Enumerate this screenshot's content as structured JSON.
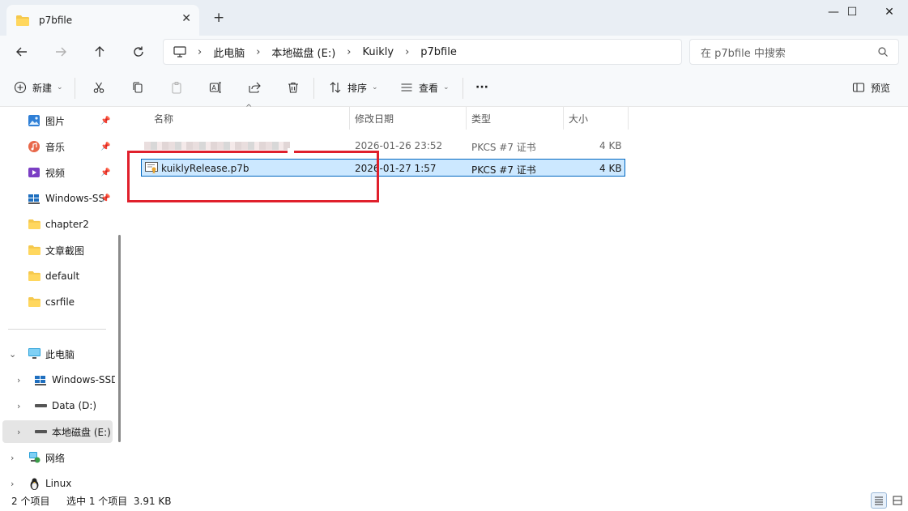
{
  "window": {
    "tab_title": "p7bfile",
    "tab_close": "✕",
    "new_tab": "+",
    "minimize": "—",
    "maximize": "☐",
    "close": "✕"
  },
  "address": {
    "breadcrumbs": [
      "此电脑",
      "本地磁盘 (E:)",
      "Kuikly",
      "p7bfile"
    ],
    "separator": "›",
    "search_placeholder": "在 p7bfile 中搜索"
  },
  "commands": {
    "new_label": "新建",
    "sort_label": "排序",
    "view_label": "查看",
    "more_label": "···",
    "preview_label": "预览"
  },
  "sidebar": {
    "quick_access": [
      {
        "label": "图片",
        "icon": "pictures-icon",
        "pinned": true
      },
      {
        "label": "音乐",
        "icon": "music-icon",
        "pinned": true
      },
      {
        "label": "视频",
        "icon": "videos-icon",
        "pinned": true
      },
      {
        "label": "Windows-SS",
        "icon": "windows-drive-icon",
        "pinned": true
      },
      {
        "label": "chapter2",
        "icon": "folder-icon",
        "pinned": false
      },
      {
        "label": "文章截图",
        "icon": "folder-icon",
        "pinned": false
      },
      {
        "label": "default",
        "icon": "folder-icon",
        "pinned": false
      },
      {
        "label": "csrfile",
        "icon": "folder-icon",
        "pinned": false
      }
    ],
    "tree": [
      {
        "label": "此电脑",
        "icon": "this-pc-icon",
        "expanded": true
      },
      {
        "label": "Windows-SSD",
        "icon": "windows-drive-icon"
      },
      {
        "label": "Data (D:)",
        "icon": "drive-icon"
      },
      {
        "label": "本地磁盘 (E:)",
        "icon": "drive-icon",
        "selected": true
      },
      {
        "label": "网络",
        "icon": "network-icon"
      },
      {
        "label": "Linux",
        "icon": "linux-icon"
      }
    ]
  },
  "file_list": {
    "columns": [
      "名称",
      "修改日期",
      "类型",
      "大小"
    ],
    "sort_indicator": "^",
    "rows": [
      {
        "name": "",
        "blurred": true,
        "modified": "2026-01-26 23:52",
        "type": "PKCS #7 证书",
        "size": "4 KB"
      },
      {
        "name": "kuiklyRelease.p7b",
        "blurred": false,
        "selected": true,
        "modified": "2026-01-27 1:57",
        "type": "PKCS #7 证书",
        "size": "4 KB"
      }
    ]
  },
  "status": {
    "item_count": "2 个项目",
    "selection": "选中 1 个项目  3.91 KB"
  },
  "colors": {
    "accent": "#0067c0",
    "selection_bg": "#cce8ff",
    "annotation_red": "#e0202c",
    "folder_yellow": "#f5c84c"
  }
}
